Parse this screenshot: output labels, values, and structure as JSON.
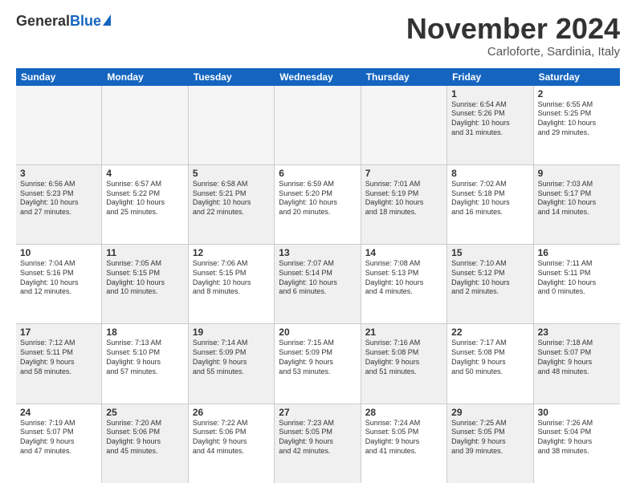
{
  "logo": {
    "general": "General",
    "blue": "Blue"
  },
  "header": {
    "month": "November 2024",
    "location": "Carloforte, Sardinia, Italy"
  },
  "days": [
    "Sunday",
    "Monday",
    "Tuesday",
    "Wednesday",
    "Thursday",
    "Friday",
    "Saturday"
  ],
  "weeks": [
    [
      {
        "day": "",
        "info": "",
        "empty": true
      },
      {
        "day": "",
        "info": "",
        "empty": true
      },
      {
        "day": "",
        "info": "",
        "empty": true
      },
      {
        "day": "",
        "info": "",
        "empty": true
      },
      {
        "day": "",
        "info": "",
        "empty": true
      },
      {
        "day": "1",
        "info": "Sunrise: 6:54 AM\nSunset: 5:26 PM\nDaylight: 10 hours\nand 31 minutes.",
        "shaded": true
      },
      {
        "day": "2",
        "info": "Sunrise: 6:55 AM\nSunset: 5:25 PM\nDaylight: 10 hours\nand 29 minutes.",
        "shaded": false
      }
    ],
    [
      {
        "day": "3",
        "info": "Sunrise: 6:56 AM\nSunset: 5:23 PM\nDaylight: 10 hours\nand 27 minutes.",
        "shaded": true
      },
      {
        "day": "4",
        "info": "Sunrise: 6:57 AM\nSunset: 5:22 PM\nDaylight: 10 hours\nand 25 minutes.",
        "shaded": false
      },
      {
        "day": "5",
        "info": "Sunrise: 6:58 AM\nSunset: 5:21 PM\nDaylight: 10 hours\nand 22 minutes.",
        "shaded": true
      },
      {
        "day": "6",
        "info": "Sunrise: 6:59 AM\nSunset: 5:20 PM\nDaylight: 10 hours\nand 20 minutes.",
        "shaded": false
      },
      {
        "day": "7",
        "info": "Sunrise: 7:01 AM\nSunset: 5:19 PM\nDaylight: 10 hours\nand 18 minutes.",
        "shaded": true
      },
      {
        "day": "8",
        "info": "Sunrise: 7:02 AM\nSunset: 5:18 PM\nDaylight: 10 hours\nand 16 minutes.",
        "shaded": false
      },
      {
        "day": "9",
        "info": "Sunrise: 7:03 AM\nSunset: 5:17 PM\nDaylight: 10 hours\nand 14 minutes.",
        "shaded": true
      }
    ],
    [
      {
        "day": "10",
        "info": "Sunrise: 7:04 AM\nSunset: 5:16 PM\nDaylight: 10 hours\nand 12 minutes.",
        "shaded": false
      },
      {
        "day": "11",
        "info": "Sunrise: 7:05 AM\nSunset: 5:15 PM\nDaylight: 10 hours\nand 10 minutes.",
        "shaded": true
      },
      {
        "day": "12",
        "info": "Sunrise: 7:06 AM\nSunset: 5:15 PM\nDaylight: 10 hours\nand 8 minutes.",
        "shaded": false
      },
      {
        "day": "13",
        "info": "Sunrise: 7:07 AM\nSunset: 5:14 PM\nDaylight: 10 hours\nand 6 minutes.",
        "shaded": true
      },
      {
        "day": "14",
        "info": "Sunrise: 7:08 AM\nSunset: 5:13 PM\nDaylight: 10 hours\nand 4 minutes.",
        "shaded": false
      },
      {
        "day": "15",
        "info": "Sunrise: 7:10 AM\nSunset: 5:12 PM\nDaylight: 10 hours\nand 2 minutes.",
        "shaded": true
      },
      {
        "day": "16",
        "info": "Sunrise: 7:11 AM\nSunset: 5:11 PM\nDaylight: 10 hours\nand 0 minutes.",
        "shaded": false
      }
    ],
    [
      {
        "day": "17",
        "info": "Sunrise: 7:12 AM\nSunset: 5:11 PM\nDaylight: 9 hours\nand 58 minutes.",
        "shaded": true
      },
      {
        "day": "18",
        "info": "Sunrise: 7:13 AM\nSunset: 5:10 PM\nDaylight: 9 hours\nand 57 minutes.",
        "shaded": false
      },
      {
        "day": "19",
        "info": "Sunrise: 7:14 AM\nSunset: 5:09 PM\nDaylight: 9 hours\nand 55 minutes.",
        "shaded": true
      },
      {
        "day": "20",
        "info": "Sunrise: 7:15 AM\nSunset: 5:09 PM\nDaylight: 9 hours\nand 53 minutes.",
        "shaded": false
      },
      {
        "day": "21",
        "info": "Sunrise: 7:16 AM\nSunset: 5:08 PM\nDaylight: 9 hours\nand 51 minutes.",
        "shaded": true
      },
      {
        "day": "22",
        "info": "Sunrise: 7:17 AM\nSunset: 5:08 PM\nDaylight: 9 hours\nand 50 minutes.",
        "shaded": false
      },
      {
        "day": "23",
        "info": "Sunrise: 7:18 AM\nSunset: 5:07 PM\nDaylight: 9 hours\nand 48 minutes.",
        "shaded": true
      }
    ],
    [
      {
        "day": "24",
        "info": "Sunrise: 7:19 AM\nSunset: 5:07 PM\nDaylight: 9 hours\nand 47 minutes.",
        "shaded": false
      },
      {
        "day": "25",
        "info": "Sunrise: 7:20 AM\nSunset: 5:06 PM\nDaylight: 9 hours\nand 45 minutes.",
        "shaded": true
      },
      {
        "day": "26",
        "info": "Sunrise: 7:22 AM\nSunset: 5:06 PM\nDaylight: 9 hours\nand 44 minutes.",
        "shaded": false
      },
      {
        "day": "27",
        "info": "Sunrise: 7:23 AM\nSunset: 5:05 PM\nDaylight: 9 hours\nand 42 minutes.",
        "shaded": true
      },
      {
        "day": "28",
        "info": "Sunrise: 7:24 AM\nSunset: 5:05 PM\nDaylight: 9 hours\nand 41 minutes.",
        "shaded": false
      },
      {
        "day": "29",
        "info": "Sunrise: 7:25 AM\nSunset: 5:05 PM\nDaylight: 9 hours\nand 39 minutes.",
        "shaded": true
      },
      {
        "day": "30",
        "info": "Sunrise: 7:26 AM\nSunset: 5:04 PM\nDaylight: 9 hours\nand 38 minutes.",
        "shaded": false
      }
    ]
  ]
}
